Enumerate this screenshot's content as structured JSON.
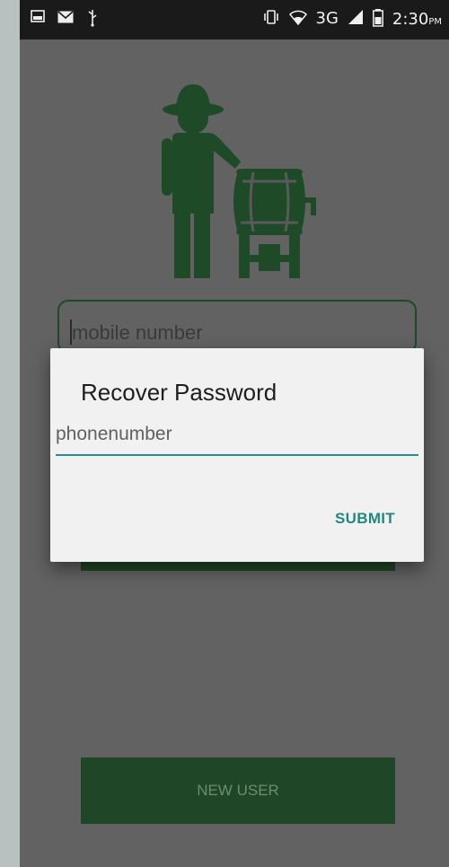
{
  "status_bar": {
    "left_icons": [
      "image-icon",
      "mail-icon",
      "usb-icon"
    ],
    "right_icons": [
      "vibrate-icon",
      "wifi-icon"
    ],
    "network": "3G",
    "signal_icon": "signal-icon",
    "battery_icon": "battery-icon",
    "time": "2:30",
    "ampm": "PM"
  },
  "login": {
    "mobile_placeholder": "mobile number",
    "new_user_label": "NEW USER"
  },
  "dialog": {
    "title": "Recover Password",
    "input_placeholder": "phonenumber",
    "submit_label": "SUBMIT"
  },
  "colors": {
    "brand_green": "#1f4626",
    "accent_teal": "#1f8a82",
    "dim_overlay": "#626262"
  }
}
